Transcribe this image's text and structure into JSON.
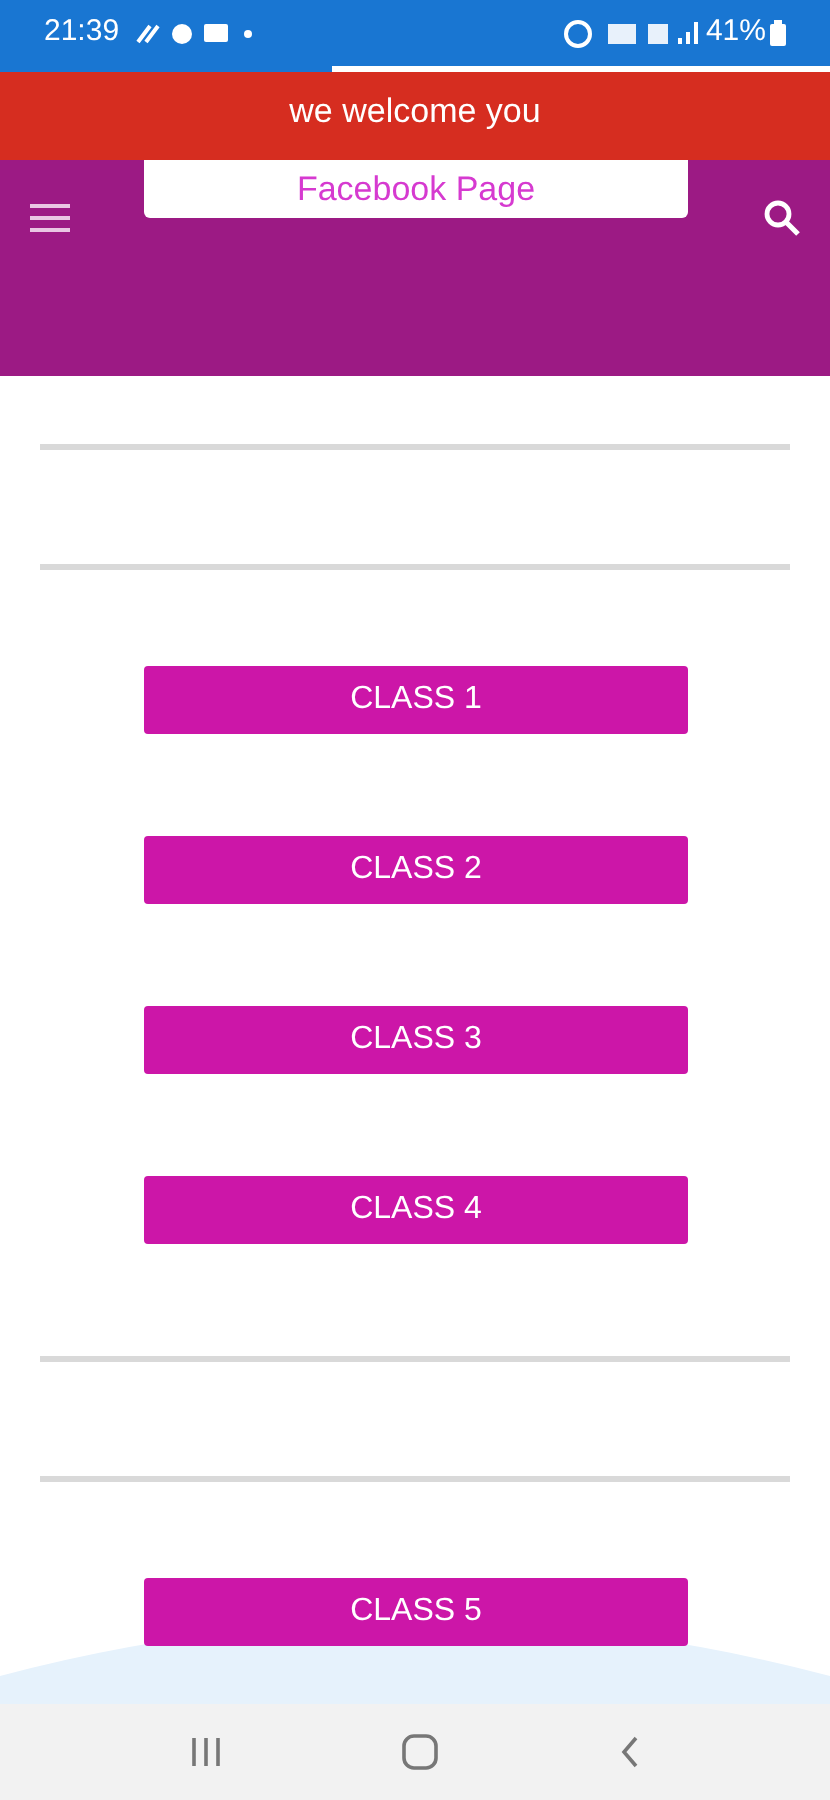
{
  "status_bar": {
    "time": "21:39",
    "battery": "41%"
  },
  "load_bar": {
    "level": 0.4
  },
  "banner": {
    "text": "we welcome you"
  },
  "app_bar": {
    "link": "Facebook Page"
  },
  "content": [
    {
      "kind": "divider"
    },
    {
      "kind": "divider"
    },
    {
      "kind": "button",
      "label": "CLASS 1"
    },
    {
      "kind": "button",
      "label": "CLASS 2"
    },
    {
      "kind": "button",
      "label": "CLASS 3"
    },
    {
      "kind": "button",
      "label": "CLASS 4"
    },
    {
      "kind": "divider"
    },
    {
      "kind": "divider"
    },
    {
      "kind": "button",
      "label": "CLASS 5"
    }
  ]
}
